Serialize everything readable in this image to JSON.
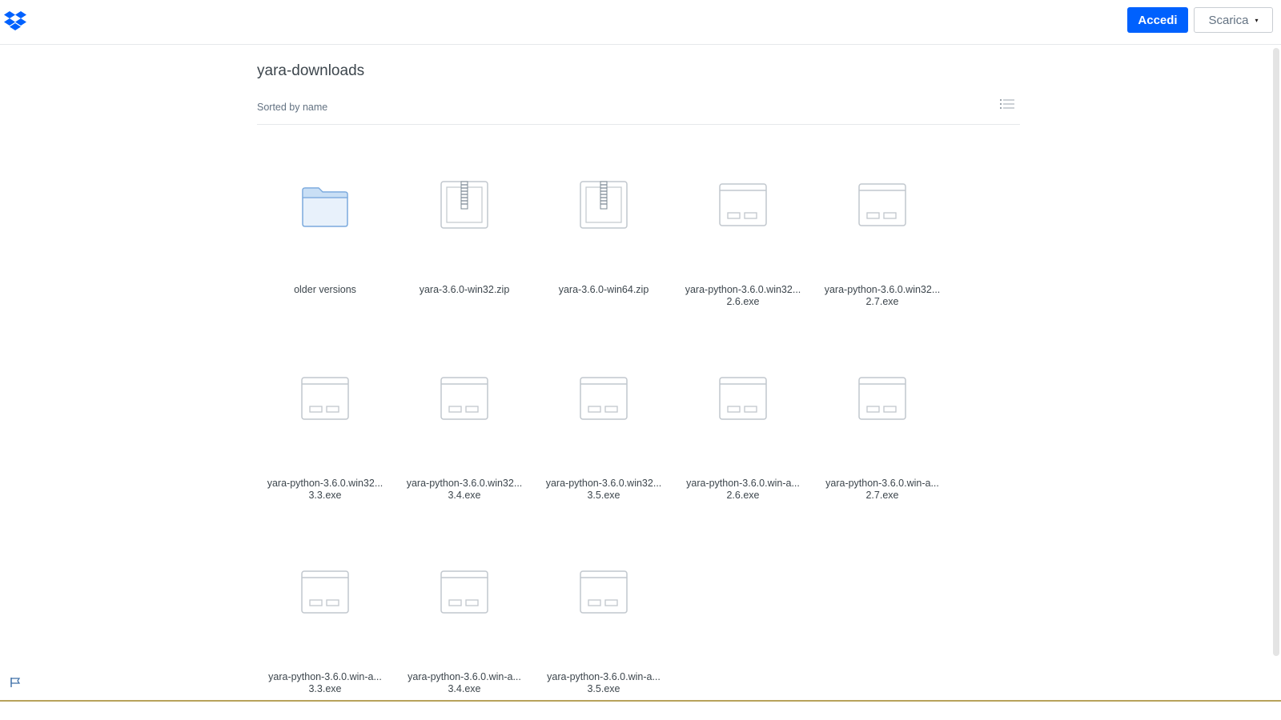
{
  "header": {
    "logo_icon": "dropbox-logo-icon",
    "signin_label": "Accedi",
    "download_label": "Scarica",
    "download_caret": "▾",
    "accent_color": "#0061fe"
  },
  "folder": {
    "title": "yara-downloads",
    "sort_label": "Sorted by name",
    "view_toggle_icon": "list-view-icon"
  },
  "files": [
    {
      "line1": "older versions",
      "line2": "",
      "type": "folder"
    },
    {
      "line1": "yara-3.6.0-win32.zip",
      "line2": "",
      "type": "zip"
    },
    {
      "line1": "yara-3.6.0-win64.zip",
      "line2": "",
      "type": "zip"
    },
    {
      "line1": "yara-python-3.6.0.win32...",
      "line2": "2.6.exe",
      "type": "exe"
    },
    {
      "line1": "yara-python-3.6.0.win32...",
      "line2": "2.7.exe",
      "type": "exe"
    },
    {
      "line1": "yara-python-3.6.0.win32...",
      "line2": "3.3.exe",
      "type": "exe"
    },
    {
      "line1": "yara-python-3.6.0.win32...",
      "line2": "3.4.exe",
      "type": "exe"
    },
    {
      "line1": "yara-python-3.6.0.win32...",
      "line2": "3.5.exe",
      "type": "exe"
    },
    {
      "line1": "yara-python-3.6.0.win-a...",
      "line2": "2.6.exe",
      "type": "exe"
    },
    {
      "line1": "yara-python-3.6.0.win-a...",
      "line2": "2.7.exe",
      "type": "exe"
    },
    {
      "line1": "yara-python-3.6.0.win-a...",
      "line2": "3.3.exe",
      "type": "exe"
    },
    {
      "line1": "yara-python-3.6.0.win-a...",
      "line2": "3.4.exe",
      "type": "exe"
    },
    {
      "line1": "yara-python-3.6.0.win-a...",
      "line2": "3.5.exe",
      "type": "exe"
    }
  ],
  "footer": {
    "feedback_icon": "flag-icon"
  }
}
